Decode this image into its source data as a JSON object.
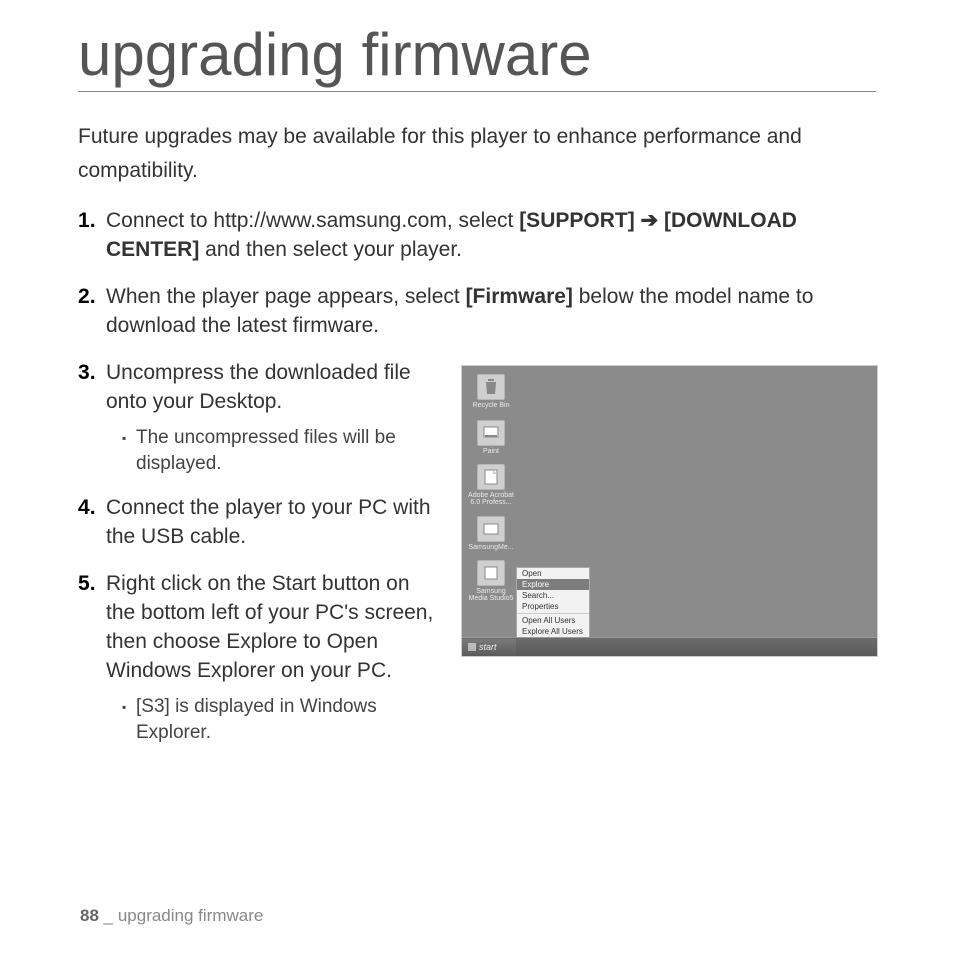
{
  "title": "upgrading firmware",
  "intro": "Future upgrades may be available for this player to enhance performance and compatibility.",
  "steps": {
    "s1_a": "Connect to http://www.samsung.com, select ",
    "s1_b": "[SUPPORT]",
    "s1_arrow": " ➔ ",
    "s1_c": "[DOWNLOAD CENTER]",
    "s1_d": " and then select your player.",
    "s2_a": "When the player page appears, select ",
    "s2_b": "[Firmware]",
    "s2_c": " below the model name to download the latest firmware.",
    "s3": "Uncompress the downloaded file onto your Desktop.",
    "s3_sub": "The uncompressed files will be displayed.",
    "s4": "Connect the player to your PC with the USB cable.",
    "s5": "Right click on the Start button on the bottom left of your PC's screen, then choose Explore to Open Windows Explorer on your PC.",
    "s5_sub": "[S3] is displayed in Windows Explorer."
  },
  "figure": {
    "icons": [
      "Recycle Bin",
      "Paint",
      "Adobe Acrobat 6.0 Profess...",
      "SamsungMe...",
      "Samsung Media Studio5"
    ],
    "menu": [
      "Open",
      "Explore",
      "Search...",
      "Properties",
      "Open All Users",
      "Explore All Users"
    ],
    "menu_selected_index": 1,
    "start": "start"
  },
  "footer": {
    "page": "88",
    "sep": " _ ",
    "section": "upgrading firmware"
  }
}
